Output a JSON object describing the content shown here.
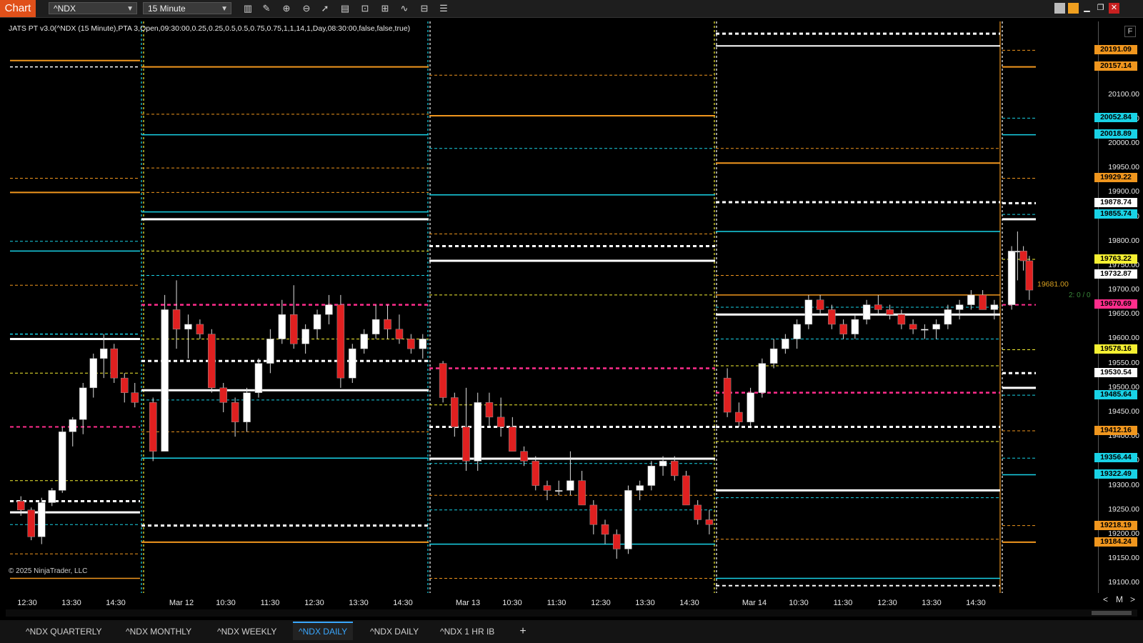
{
  "toolbar": {
    "chart_label": "Chart",
    "instrument": "^NDX",
    "interval": "15 Minute"
  },
  "indicator_label": "JATS PT v3.0(^NDX (15 Minute),PTA 3,Open,09:30:00,0.25,0.25,0.5,0.5,0.75,0.75,1,1,14,1,Day,08:30:00,false,false,true)",
  "copyright": "© 2025 NinjaTrader, LLC",
  "price_axis": {
    "labels": [
      "20100.00",
      "20050.00",
      "20000.00",
      "19950.00",
      "19900.00",
      "19850.00",
      "19800.00",
      "19750.00",
      "19700.00",
      "19650.00",
      "19600.00",
      "19550.00",
      "19500.00",
      "19450.00",
      "19400.00",
      "19350.00",
      "19300.00",
      "19250.00",
      "19200.00",
      "19150.00",
      "19100.00"
    ],
    "badges": [
      {
        "text": "20191.09",
        "color": "#f0961e"
      },
      {
        "text": "20157.14",
        "color": "#f0961e"
      },
      {
        "text": "20052.84",
        "color": "#19d2e6"
      },
      {
        "text": "20018.89",
        "color": "#19d2e6"
      },
      {
        "text": "19929.22",
        "color": "#f0961e"
      },
      {
        "text": "19878.74",
        "color": "#ffffff"
      },
      {
        "text": "19855.74",
        "color": "#19d2e6"
      },
      {
        "text": "19763.22",
        "color": "#f5f032"
      },
      {
        "text": "19732.87",
        "color": "#ffffff"
      },
      {
        "text": "19670.69",
        "color": "#ff2d8c"
      },
      {
        "text": "19578.16",
        "color": "#f5f032"
      },
      {
        "text": "19530.54",
        "color": "#ffffff"
      },
      {
        "text": "19485.64",
        "color": "#19d2e6"
      },
      {
        "text": "19412.16",
        "color": "#f0961e"
      },
      {
        "text": "19356.44",
        "color": "#19d2e6"
      },
      {
        "text": "19322.49",
        "color": "#19d2e6"
      },
      {
        "text": "19218.19",
        "color": "#f0961e"
      },
      {
        "text": "19184.24",
        "color": "#f0961e"
      }
    ],
    "last_price": "19681.00",
    "note": "2: 0 / 0",
    "nav_left": "<",
    "nav_mid": "M",
    "nav_right": ">",
    "f_button": "F"
  },
  "time_axis": [
    "12:30",
    "13:30",
    "14:30",
    "Mar 12",
    "10:30",
    "11:30",
    "12:30",
    "13:30",
    "14:30",
    "Mar 13",
    "10:30",
    "11:30",
    "12:30",
    "13:30",
    "14:30",
    "Mar 14",
    "10:30",
    "11:30",
    "12:30",
    "13:30",
    "14:30"
  ],
  "tabs": [
    {
      "label": "^NDX QUARTERLY",
      "active": false
    },
    {
      "label": "^NDX MONTHLY",
      "active": false
    },
    {
      "label": "^NDX WEEKLY",
      "active": false
    },
    {
      "label": "^NDX DAILY",
      "active": true
    },
    {
      "label": "^NDX DAILY",
      "active": false
    },
    {
      "label": "^NDX 1 HR IB",
      "active": false
    }
  ],
  "add_tab": "+",
  "colors": {
    "orange": "#f0961e",
    "cyan": "#19d2e6",
    "white": "#ffffff",
    "yellow": "#f5f032",
    "magenta": "#ff2d8c",
    "bull": "#ffffff",
    "bear": "#e02020"
  },
  "chart_data": {
    "type": "candlestick",
    "y_range": [
      19080,
      20250
    ],
    "candles": [
      [
        19268,
        19278,
        19238,
        19250
      ],
      [
        19250,
        19255,
        19188,
        19195
      ],
      [
        19195,
        19275,
        19180,
        19265
      ],
      [
        19265,
        19295,
        19258,
        19290
      ],
      [
        19290,
        19420,
        19285,
        19410
      ],
      [
        19410,
        19440,
        19380,
        19435
      ],
      [
        19435,
        19510,
        19405,
        19500
      ],
      [
        19500,
        19570,
        19480,
        19560
      ],
      [
        19560,
        19610,
        19520,
        19580
      ],
      [
        19580,
        19590,
        19510,
        19520
      ],
      [
        19520,
        19530,
        19470,
        19490
      ],
      [
        19490,
        19510,
        19460,
        19470
      ],
      [
        19470,
        19480,
        19350,
        19370
      ],
      [
        19370,
        19690,
        19370,
        19660
      ],
      [
        19660,
        19720,
        19580,
        19620
      ],
      [
        19620,
        19650,
        19560,
        19630
      ],
      [
        19630,
        19640,
        19600,
        19610
      ],
      [
        19610,
        19620,
        19490,
        19500
      ],
      [
        19500,
        19510,
        19450,
        19470
      ],
      [
        19470,
        19480,
        19400,
        19430
      ],
      [
        19430,
        19500,
        19410,
        19490
      ],
      [
        19490,
        19560,
        19480,
        19550
      ],
      [
        19550,
        19620,
        19530,
        19600
      ],
      [
        19600,
        19680,
        19590,
        19650
      ],
      [
        19650,
        19710,
        19580,
        19590
      ],
      [
        19590,
        19630,
        19570,
        19620
      ],
      [
        19620,
        19660,
        19600,
        19650
      ],
      [
        19650,
        19690,
        19630,
        19670
      ],
      [
        19670,
        19690,
        19500,
        19520
      ],
      [
        19520,
        19590,
        19510,
        19580
      ],
      [
        19580,
        19620,
        19570,
        19610
      ],
      [
        19610,
        19670,
        19600,
        19640
      ],
      [
        19640,
        19670,
        19600,
        19620
      ],
      [
        19620,
        19650,
        19590,
        19600
      ],
      [
        19600,
        19610,
        19570,
        19580
      ],
      [
        19580,
        19610,
        19560,
        19600
      ],
      [
        19550,
        19555,
        19470,
        19480
      ],
      [
        19480,
        19490,
        19400,
        19420
      ],
      [
        19420,
        19500,
        19330,
        19350
      ],
      [
        19350,
        19490,
        19330,
        19470
      ],
      [
        19470,
        19490,
        19420,
        19440
      ],
      [
        19440,
        19480,
        19400,
        19420
      ],
      [
        19420,
        19440,
        19370,
        19370
      ],
      [
        19370,
        19380,
        19340,
        19350
      ],
      [
        19350,
        19360,
        19290,
        19300
      ],
      [
        19300,
        19310,
        19270,
        19290
      ],
      [
        19290,
        19310,
        19280,
        19290
      ],
      [
        19290,
        19370,
        19280,
        19310
      ],
      [
        19310,
        19330,
        19260,
        19260
      ],
      [
        19260,
        19270,
        19200,
        19220
      ],
      [
        19220,
        19230,
        19180,
        19200
      ],
      [
        19200,
        19210,
        19150,
        19170
      ],
      [
        19170,
        19300,
        19160,
        19290
      ],
      [
        19290,
        19310,
        19270,
        19300
      ],
      [
        19300,
        19350,
        19290,
        19340
      ],
      [
        19340,
        19360,
        19320,
        19350
      ],
      [
        19350,
        19360,
        19310,
        19320
      ],
      [
        19320,
        19330,
        19270,
        19260
      ],
      [
        19260,
        19270,
        19220,
        19230
      ],
      [
        19230,
        19250,
        19200,
        19220
      ],
      [
        19520,
        19540,
        19440,
        19450
      ],
      [
        19450,
        19470,
        19420,
        19430
      ],
      [
        19430,
        19500,
        19420,
        19490
      ],
      [
        19490,
        19560,
        19480,
        19550
      ],
      [
        19550,
        19600,
        19540,
        19580
      ],
      [
        19580,
        19610,
        19570,
        19600
      ],
      [
        19600,
        19640,
        19580,
        19630
      ],
      [
        19630,
        19690,
        19620,
        19680
      ],
      [
        19680,
        19690,
        19650,
        19660
      ],
      [
        19660,
        19670,
        19620,
        19630
      ],
      [
        19630,
        19640,
        19600,
        19610
      ],
      [
        19610,
        19650,
        19600,
        19640
      ],
      [
        19640,
        19680,
        19630,
        19670
      ],
      [
        19670,
        19690,
        19650,
        19660
      ],
      [
        19660,
        19670,
        19640,
        19650
      ],
      [
        19650,
        19660,
        19620,
        19630
      ],
      [
        19630,
        19640,
        19610,
        19620
      ],
      [
        19620,
        19630,
        19600,
        19620
      ],
      [
        19620,
        19640,
        19600,
        19630
      ],
      [
        19630,
        19670,
        19620,
        19660
      ],
      [
        19660,
        19680,
        19640,
        19670
      ],
      [
        19670,
        19700,
        19660,
        19690
      ],
      [
        19690,
        19700,
        19660,
        19660
      ],
      [
        19660,
        19680,
        19640,
        19670
      ],
      [
        19670,
        19790,
        19660,
        19780
      ],
      [
        19780,
        19820,
        19720,
        19780
      ],
      [
        19780,
        19790,
        19740,
        19760
      ],
      [
        19760,
        19770,
        19680,
        19700
      ]
    ]
  }
}
